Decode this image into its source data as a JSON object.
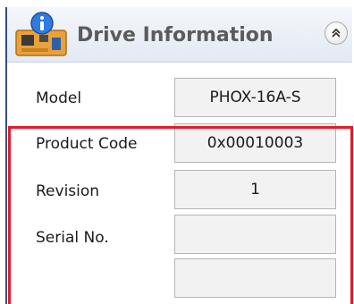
{
  "header": {
    "title": "Drive Information",
    "icon": "drive-info-icon",
    "collapse_icon": "double-chevron-up-icon"
  },
  "fields": [
    {
      "label": "Model",
      "value": "PHOX-16A-S"
    },
    {
      "label": "Product Code",
      "value": "0x00010003"
    },
    {
      "label": "Revision",
      "value": "1"
    },
    {
      "label": "Serial No.",
      "value": ""
    },
    {
      "label": "",
      "value": ""
    }
  ],
  "colors": {
    "highlight": "#e21b2a",
    "panel_accent": "#33507c",
    "value_bg": "#f2f2f2"
  }
}
